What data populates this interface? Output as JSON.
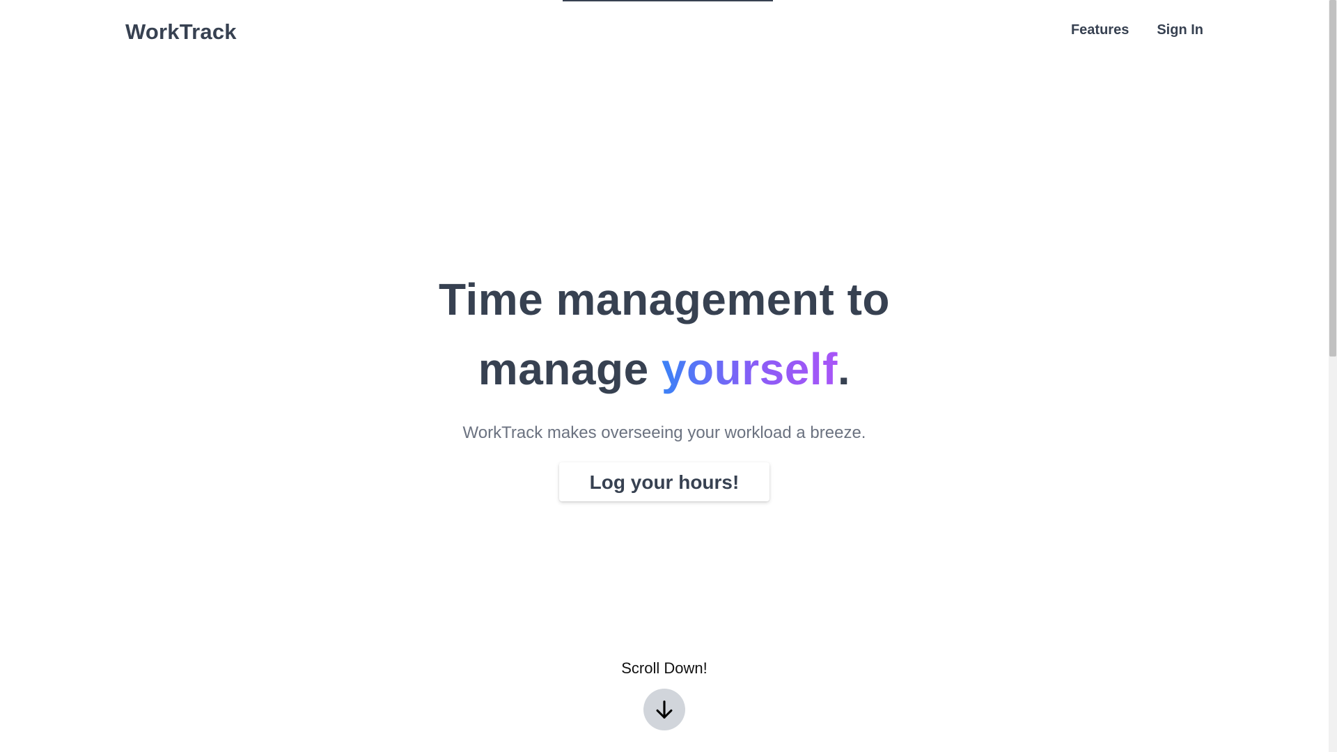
{
  "header": {
    "brand": "WorkTrack",
    "nav": [
      {
        "label": "Features"
      },
      {
        "label": "Sign In"
      }
    ]
  },
  "hero": {
    "headline_line1": "Time management to",
    "headline_line2_prefix": "manage ",
    "headline_highlight": "yourself",
    "headline_suffix": ".",
    "subtitle": "WorkTrack makes overseeing your workload a breeze.",
    "cta_label": "Log your hours!"
  },
  "scroll": {
    "label": "Scroll Down!",
    "icon": "arrow-down-icon"
  },
  "colors": {
    "text_dark": "#374151",
    "text_muted": "#6b7280",
    "gradient_start": "#3b82f6",
    "gradient_end": "#a855f7",
    "scroll_button_bg": "#d1d5db"
  }
}
